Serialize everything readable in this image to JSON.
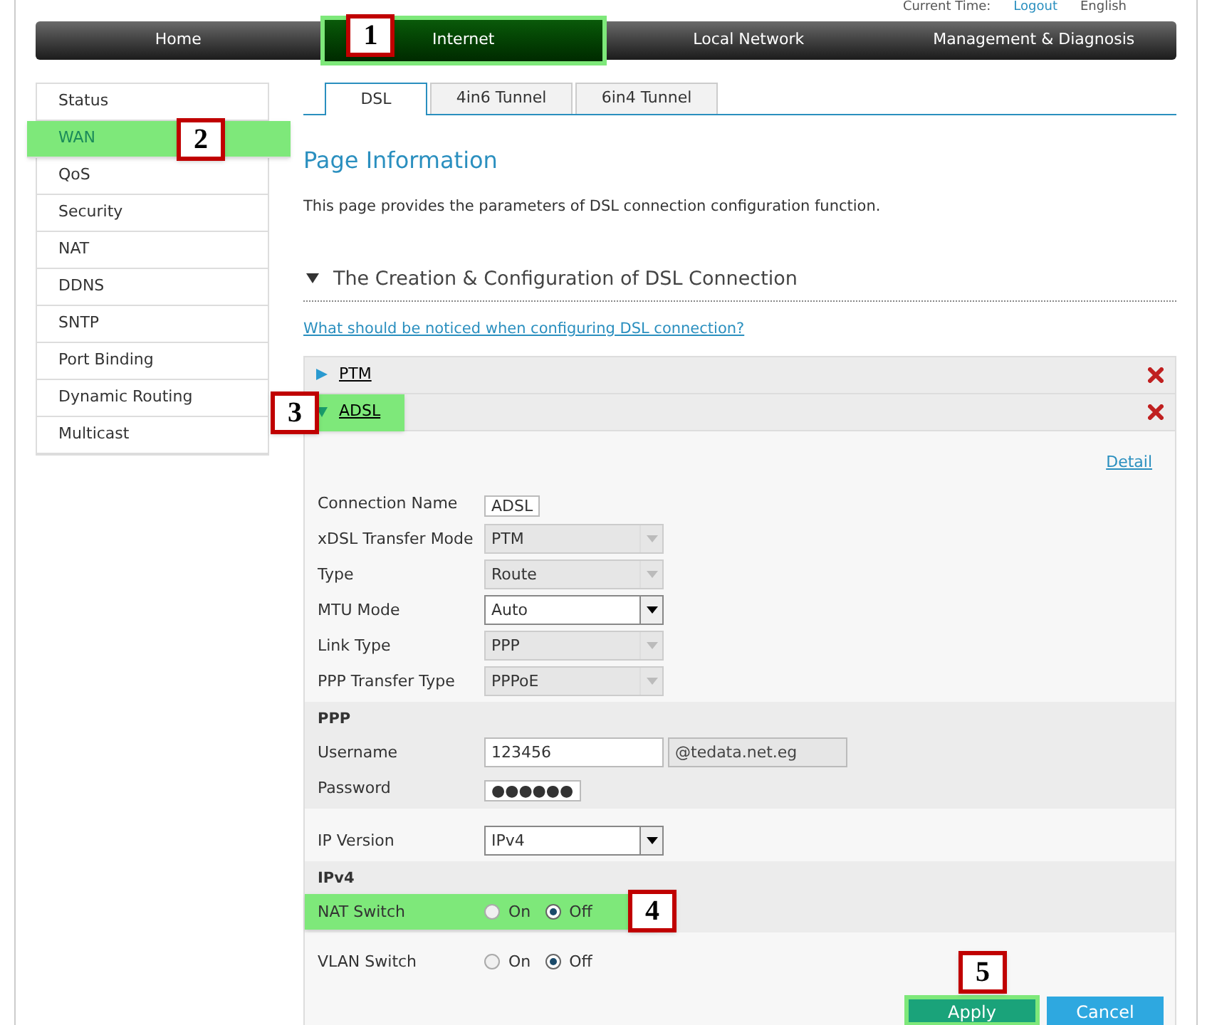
{
  "top_bar": {
    "time_label": "Current Time:",
    "logout": "Logout",
    "language": "English"
  },
  "nav": [
    {
      "label": "Home",
      "selected": false
    },
    {
      "label": "Internet",
      "selected": true,
      "callout": "1"
    },
    {
      "label": "Local Network",
      "selected": false
    },
    {
      "label": "Management & Diagnosis",
      "selected": false
    }
  ],
  "sidebar": [
    {
      "label": "Status",
      "selected": false
    },
    {
      "label": "WAN",
      "selected": true,
      "callout": "2"
    },
    {
      "label": "QoS",
      "selected": false
    },
    {
      "label": "Security",
      "selected": false
    },
    {
      "label": "NAT",
      "selected": false
    },
    {
      "label": "DDNS",
      "selected": false
    },
    {
      "label": "SNTP",
      "selected": false
    },
    {
      "label": "Port Binding",
      "selected": false
    },
    {
      "label": "Dynamic Routing",
      "selected": false
    },
    {
      "label": "Multicast",
      "selected": false
    }
  ],
  "tabs": [
    {
      "label": "DSL",
      "selected": true
    },
    {
      "label": "4in6 Tunnel",
      "selected": false
    },
    {
      "label": "6in4 Tunnel",
      "selected": false
    }
  ],
  "page_title": "Page Information",
  "description": "This page provides the parameters of DSL connection configuration function.",
  "section_title": "The Creation & Configuration of DSL Connection",
  "notice_link": "What should be noticed when configuring DSL connection?",
  "connections": [
    {
      "name": "PTM",
      "expanded": false
    },
    {
      "name": "ADSL",
      "expanded": true,
      "callout": "3"
    }
  ],
  "detail_link": "Detail",
  "groups": [
    {
      "rows": [
        {
          "kind": "text",
          "label": "Connection Name",
          "value": "ADSL"
        },
        {
          "kind": "select",
          "label": "xDSL Transfer Mode",
          "value": "PTM",
          "disabled": true
        },
        {
          "kind": "select",
          "label": "Type",
          "value": "Route",
          "disabled": true
        },
        {
          "kind": "select",
          "label": "MTU Mode",
          "value": "Auto",
          "disabled": false
        },
        {
          "kind": "select",
          "label": "Link Type",
          "value": "PPP",
          "disabled": true
        },
        {
          "kind": "select",
          "label": "PPP Transfer Type",
          "value": "PPPoE",
          "disabled": true
        }
      ]
    },
    {
      "title": "PPP",
      "rows": [
        {
          "kind": "suffix",
          "label": "Username",
          "value": "123456",
          "suffix": "@tedata.net.eg"
        },
        {
          "kind": "text",
          "label": "Password",
          "value": "●●●●●●"
        }
      ]
    },
    {
      "rows": [
        {
          "kind": "select",
          "label": "IP Version",
          "value": "IPv4",
          "disabled": false
        }
      ]
    },
    {
      "title": "IPv4",
      "rows": [
        {
          "kind": "radio",
          "label": "NAT Switch",
          "callout": "4",
          "options": [
            {
              "label": "On",
              "selected": false
            },
            {
              "label": "Off",
              "selected": true
            }
          ]
        }
      ]
    },
    {
      "rows": [
        {
          "kind": "radio",
          "label": "VLAN Switch",
          "options": [
            {
              "label": "On",
              "selected": false
            },
            {
              "label": "Off",
              "selected": true
            }
          ]
        }
      ]
    }
  ],
  "buttons": [
    {
      "label": "Apply",
      "kind": "primary",
      "callout": "5"
    },
    {
      "label": "Cancel",
      "kind": "secondary"
    }
  ]
}
